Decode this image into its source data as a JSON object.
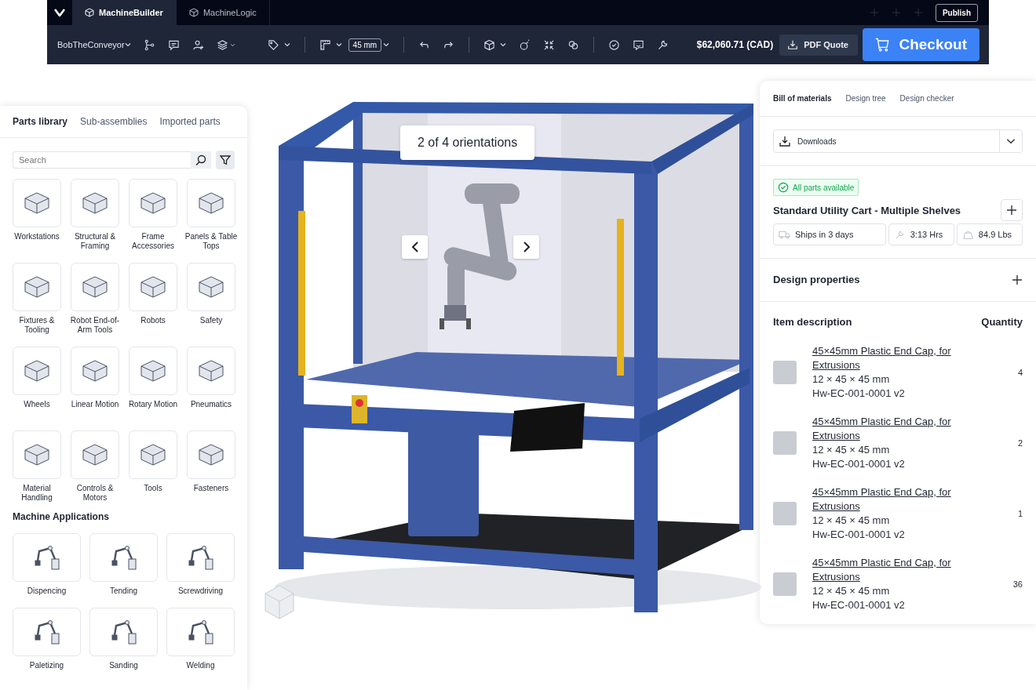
{
  "app_bar": {
    "tabs": [
      {
        "label": "MachineBuilder",
        "selected": true
      },
      {
        "label": "MachineLogic",
        "selected": false
      }
    ],
    "publish_button": "Publish"
  },
  "toolbar": {
    "project": "BobTheConveyor",
    "grid_size": "45 mm",
    "price": "$62,060.71 (CAD)",
    "pdf_button": "PDF Quote",
    "checkout_button": "Checkout"
  },
  "viewport": {
    "tooltip": "2 of 4 orientations"
  },
  "parts_panel": {
    "tabs": [
      {
        "label": "Parts library",
        "selected": true
      },
      {
        "label": "Sub-assemblies",
        "selected": false
      },
      {
        "label": "Imported parts",
        "selected": false
      }
    ],
    "search": {
      "placeholder": "Search"
    },
    "categories": [
      "Workstations",
      "Structural & Framing",
      "Frame Accessories",
      "Panels & Table Tops",
      "Fixtures & Tooling",
      "Robot End-of-Arm Tools",
      "Robots",
      "Safety",
      "Wheels",
      "Linear Motion",
      "Rotary Motion",
      "Pneumatics",
      "Material Handling",
      "Controls & Motors",
      "Tools",
      "Fasteners"
    ],
    "applications_title": "Machine Applications",
    "applications": [
      "Dispencing",
      "Tending",
      "Screwdriving",
      "Paletizing",
      "Sanding",
      "Welding"
    ]
  },
  "bom_panel": {
    "tabs": [
      {
        "label": "Bill of materials",
        "selected": true
      },
      {
        "label": "Design tree",
        "selected": false
      },
      {
        "label": "Design checker",
        "selected": false
      }
    ],
    "downloads": "Downloads",
    "availability": "All parts available",
    "design_title": "Standard Utility Cart - Multiple Shelves",
    "stats": [
      {
        "kind": "shipping",
        "text": "Ships in 3 days"
      },
      {
        "kind": "time",
        "text": "3:13 Hrs"
      },
      {
        "kind": "weight",
        "text": "84.9 Lbs"
      }
    ],
    "design_properties": "Design properties",
    "columns": [
      "Item description",
      "Quantity"
    ],
    "items": [
      {
        "name": "45×45mm Plastic End Cap, for Extrusions",
        "size": "12 × 45 × 45 mm",
        "sku": "Hw-EC-001-0001 v2",
        "quantity": "4"
      },
      {
        "name": "45×45mm Plastic End Cap, for Extrusions",
        "size": "12 × 45 × 45 mm",
        "sku": "Hw-EC-001-0001 v2",
        "quantity": "2"
      },
      {
        "name": "45×45mm Plastic End Cap, for Extrusions",
        "size": "12 × 45 × 45 mm",
        "sku": "Hw-EC-001-0001 v2",
        "quantity": "1"
      },
      {
        "name": "45×45mm Plastic End Cap, for Extrusions",
        "size": "12 × 45 × 45 mm",
        "sku": "Hw-EC-001-0001 v2",
        "quantity": "36"
      }
    ]
  }
}
